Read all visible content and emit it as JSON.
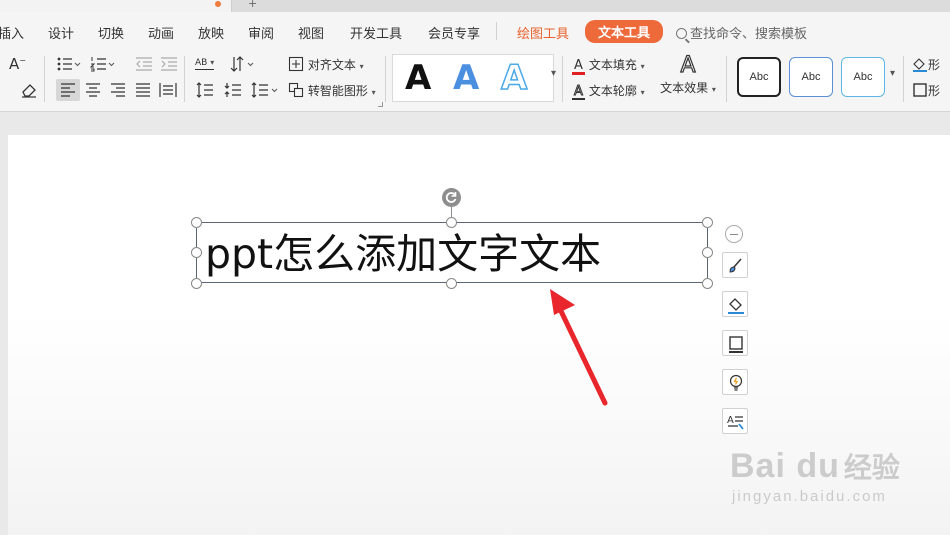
{
  "menu": {
    "items": [
      "插入",
      "设计",
      "切换",
      "动画",
      "放映",
      "审阅",
      "视图",
      "开发工具",
      "会员专享"
    ],
    "context_tabs": [
      "绘图工具",
      "文本工具"
    ],
    "active_tab": "文本工具",
    "search_placeholder": "查找命令、搜索模板"
  },
  "ribbon": {
    "align_text_label": "对齐文本",
    "smart_shape_label": "转智能图形",
    "text_fill_label": "文本填充",
    "text_outline_label": "文本轮廓",
    "text_effect_label": "文本效果",
    "shape_style_sample": "Abc",
    "text_direction_label": "AB",
    "font_decrease_label": "A",
    "preset_letters": [
      "A",
      "A",
      "A"
    ],
    "right_cut_labels": [
      "形",
      "形"
    ]
  },
  "slide": {
    "textbox_text": "ppt怎么添加文字文本"
  },
  "side_tools": [
    "brush-icon",
    "fill-icon",
    "outline-icon",
    "idea-bulb-icon",
    "text-select-icon"
  ],
  "watermark": {
    "logo": "Bai  du",
    "cn": "经验",
    "url": "jingyan.baidu.com"
  },
  "colors": {
    "accent": "#ee6a3a",
    "context_tab": "#e8612c",
    "arrow": "#e8262b",
    "blue_text": "#4a8fe0"
  }
}
